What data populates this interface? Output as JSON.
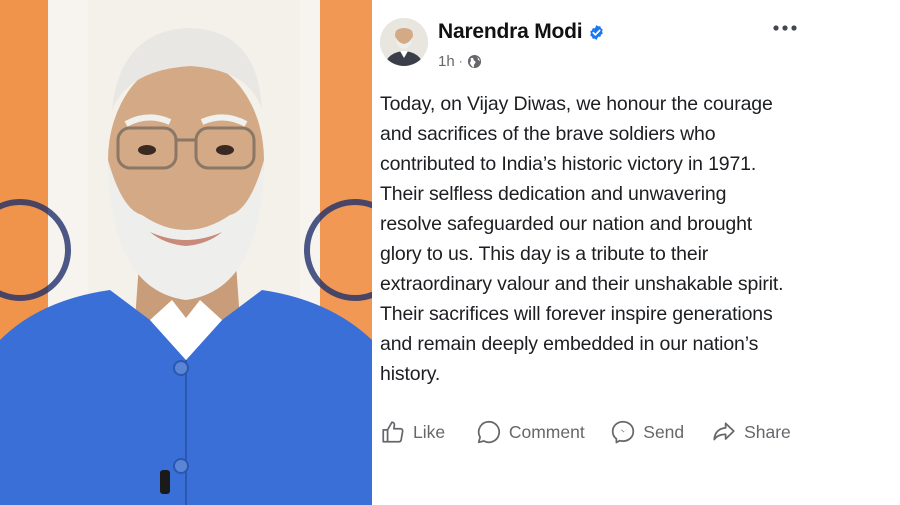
{
  "post": {
    "author": "Narendra Modi",
    "verified": true,
    "time": "1h",
    "dot": "·",
    "audience_icon": "globe-icon",
    "more_icon": "more-options-icon",
    "text": "Today, on Vijay Diwas, we honour the courage and sacrifices of the brave soldiers who contributed to India’s historic victory in 1971. Their selfless dedication and unwavering resolve safeguarded our nation and brought glory to us. This day is a tribute to their extraordinary valour and their unshakable spirit. Their sacrifices will forever inspire generations and remain deeply embedded in our nation’s history."
  },
  "actions": {
    "like": "Like",
    "comment": "Comment",
    "send": "Send",
    "share": "Share"
  },
  "colors": {
    "verified_blue": "#1877f2",
    "muted_text": "#65676b",
    "body_text": "#1c1e21",
    "jacket_blue": "#3a6fd8",
    "flag_saffron": "#f08a3a",
    "flag_green": "#2f7d3a",
    "chakra_navy": "#1f2f6a"
  }
}
